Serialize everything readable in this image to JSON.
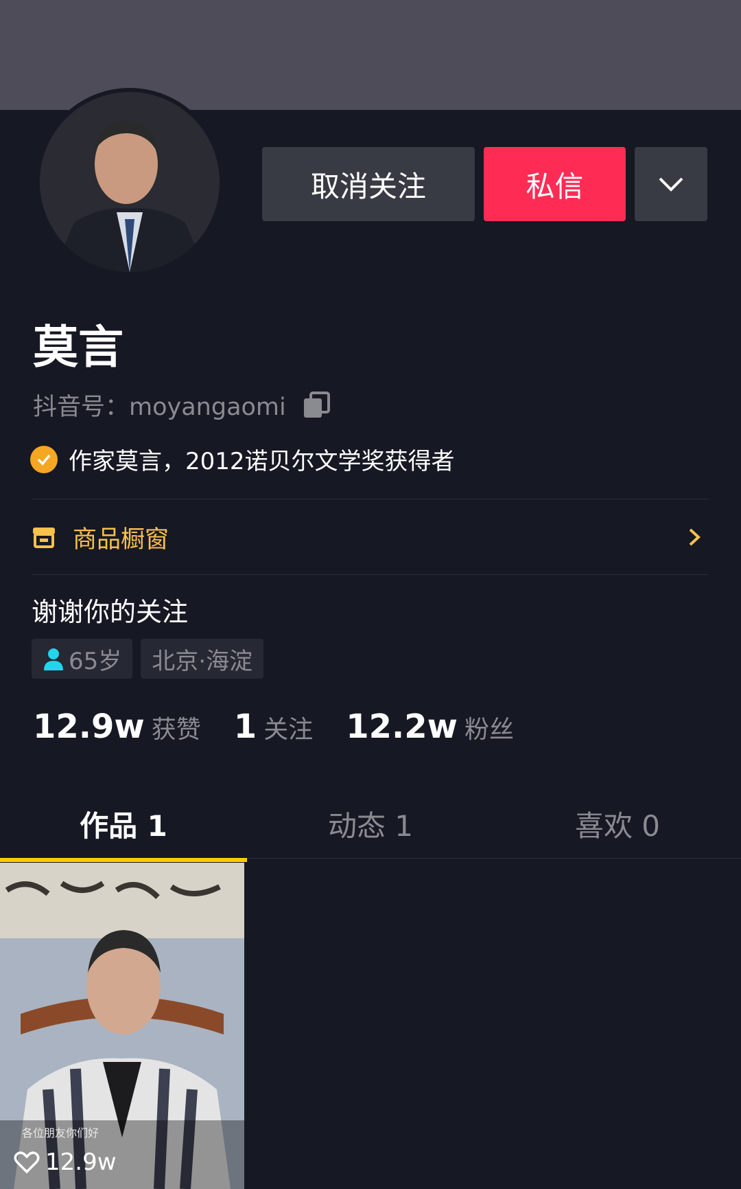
{
  "profile": {
    "name": "莫言",
    "douyin_id": "抖音号：moyangaomi",
    "verification": "作家莫言，2012诺贝尔文学奖获得者",
    "bio": "谢谢你的关注",
    "tags": [
      {
        "icon": "person-icon",
        "label": "65岁"
      },
      {
        "label": "北京·海淀"
      }
    ]
  },
  "actions": {
    "unfollow_label": "取消关注",
    "message_label": "私信",
    "more_icon": "chevron-down-icon"
  },
  "shop": {
    "label": "商品橱窗",
    "icon": "storefront-icon"
  },
  "stats": [
    {
      "value": "12.9w",
      "label": "获赞"
    },
    {
      "value": "1",
      "label": "关注"
    },
    {
      "value": "12.2w",
      "label": "粉丝"
    }
  ],
  "tabs": [
    {
      "label": "作品 1",
      "active": true
    },
    {
      "label": "动态 1",
      "active": false
    },
    {
      "label": "喜欢 0",
      "active": false
    }
  ],
  "videos": [
    {
      "caption": "各位朋友你们好",
      "likes": "12.9w"
    }
  ],
  "colors": {
    "background": "#161823",
    "accent_red": "#fe2c55",
    "accent_yellow": "#facd00",
    "shop_gold": "#f8c14b",
    "verify_orange": "#f5a623"
  }
}
